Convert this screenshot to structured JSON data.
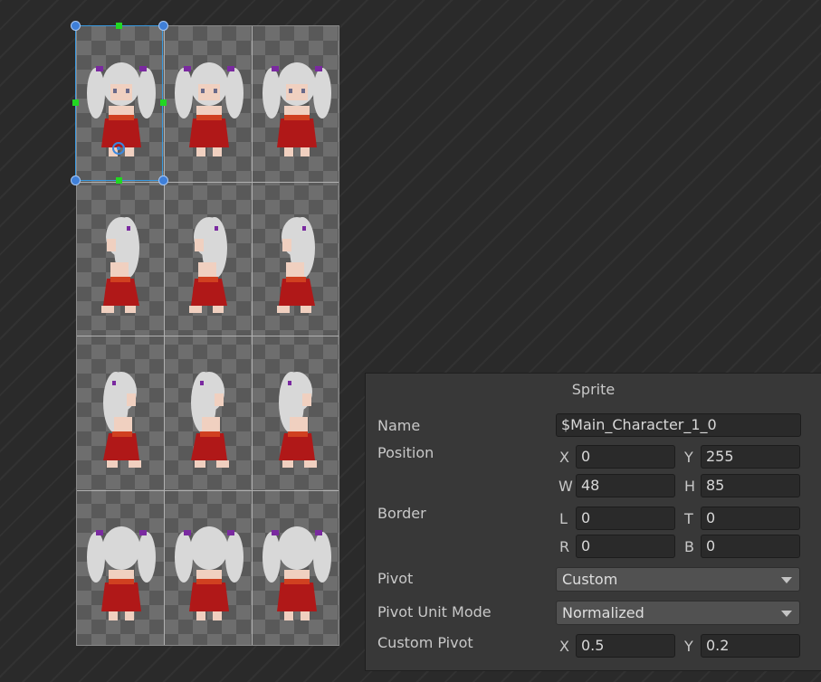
{
  "panel": {
    "title": "Sprite",
    "name_label": "Name",
    "name_value": "$Main_Character_1_0",
    "position_label": "Position",
    "pos_x_label": "X",
    "pos_x": "0",
    "pos_y_label": "Y",
    "pos_y": "255",
    "pos_w_label": "W",
    "pos_w": "48",
    "pos_h_label": "H",
    "pos_h": "85",
    "border_label": "Border",
    "border_l_label": "L",
    "border_l": "0",
    "border_t_label": "T",
    "border_t": "0",
    "border_r_label": "R",
    "border_r": "0",
    "border_b_label": "B",
    "border_b": "0",
    "pivot_label": "Pivot",
    "pivot_value": "Custom",
    "pivot_unit_label": "Pivot Unit Mode",
    "pivot_unit_value": "Normalized",
    "custom_pivot_label": "Custom Pivot",
    "cp_x_label": "X",
    "cp_x": "0.5",
    "cp_y_label": "Y",
    "cp_y": "0.2"
  },
  "sprite_sheet": {
    "rows": 4,
    "cols": 3,
    "directions": [
      "front",
      "left",
      "right",
      "back"
    ],
    "selected_cell": "row 1, column 1",
    "colors": {
      "hair": "#d8d8d8",
      "dress": "#b01818",
      "sash": "#d04020",
      "skin": "#f0d0c0",
      "ribbon": "#7a2aa0"
    }
  },
  "colors": {
    "selection": "#3a9ae0",
    "handle": "#3f7fd8",
    "edge_handle": "#22d722",
    "panel_bg": "#383838"
  }
}
